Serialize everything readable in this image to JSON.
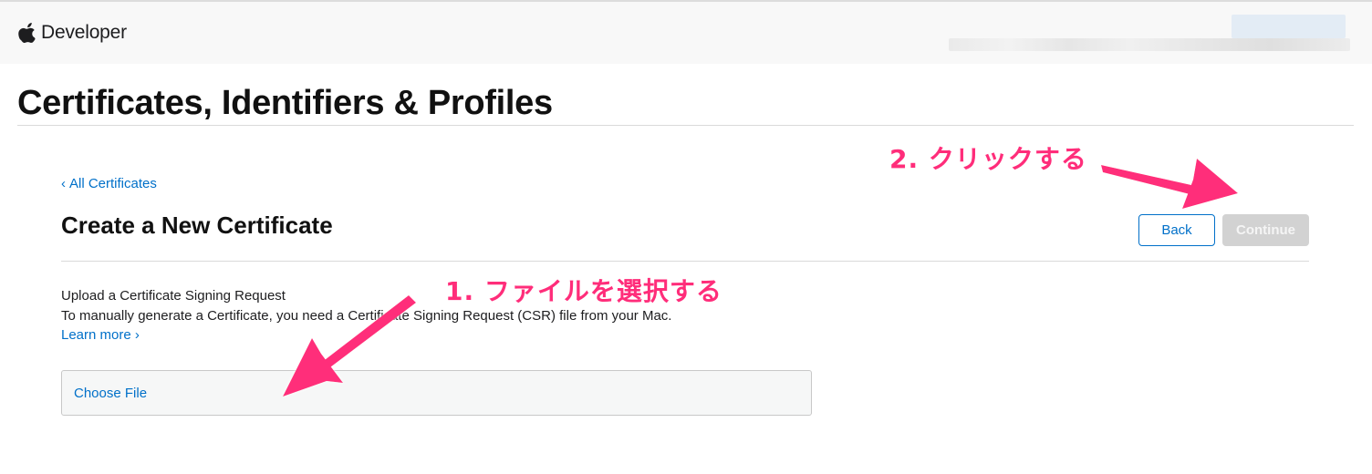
{
  "header": {
    "brand": "Developer",
    "icon": "apple-logo-icon"
  },
  "page": {
    "title": "Certificates, Identifiers & Profiles"
  },
  "content": {
    "back_link_chevron": "‹",
    "back_link": "All Certificates",
    "section_title": "Create a New Certificate",
    "back_button": "Back",
    "continue_button": "Continue",
    "upload_heading": "Upload a Certificate Signing Request",
    "upload_desc": "To manually generate a Certificate, you need a Certificate Signing Request (CSR) file from your Mac.",
    "learn_more": "Learn more ›",
    "choose_file": "Choose File"
  },
  "annotations": {
    "step1": "1. ファイルを選択する",
    "step2": "2. クリックする",
    "color": "#ff2d7a"
  },
  "colors": {
    "link": "#0070c9",
    "disabled_button": "#d2d2d2"
  }
}
